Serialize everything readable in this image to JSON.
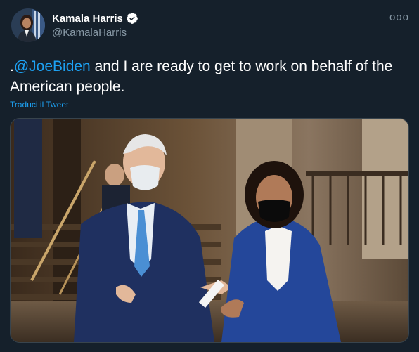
{
  "author": {
    "display_name": "Kamala Harris",
    "handle": "@KamalaHarris",
    "verified_icon": "verified-badge-icon",
    "avatar_icon": "avatar-photo"
  },
  "more_icon_label": "ooo",
  "tweet": {
    "prefix": ".",
    "mention": "@JoeBiden",
    "body": " and I are ready to get to work on behalf of the American people."
  },
  "translate_label": "Traduci il Tweet",
  "media": {
    "type": "photo",
    "description_icon": "photo-two-people-walking"
  },
  "colors": {
    "background": "#15202b",
    "accent": "#1da1f2",
    "secondary_text": "#8899a6"
  }
}
